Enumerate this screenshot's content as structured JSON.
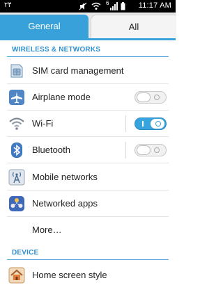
{
  "status_bar": {
    "left_text": "۲۴",
    "signal_label": "6",
    "time": "11:17 AM"
  },
  "tabs": {
    "general": "General",
    "all": "All"
  },
  "sections": {
    "wireless": "WIRELESS & NETWORKS",
    "device": "DEVICE"
  },
  "items": {
    "sim": "SIM card management",
    "airplane": "Airplane mode",
    "wifi": "Wi-Fi",
    "bluetooth": "Bluetooth",
    "mobile": "Mobile networks",
    "netapps": "Networked apps",
    "more": "More…",
    "home": "Home screen style"
  },
  "toggles": {
    "airplane": "off",
    "wifi": "on",
    "bluetooth": "off"
  },
  "colors": {
    "accent": "#38a1d9",
    "section_text": "#2f8fd0"
  }
}
